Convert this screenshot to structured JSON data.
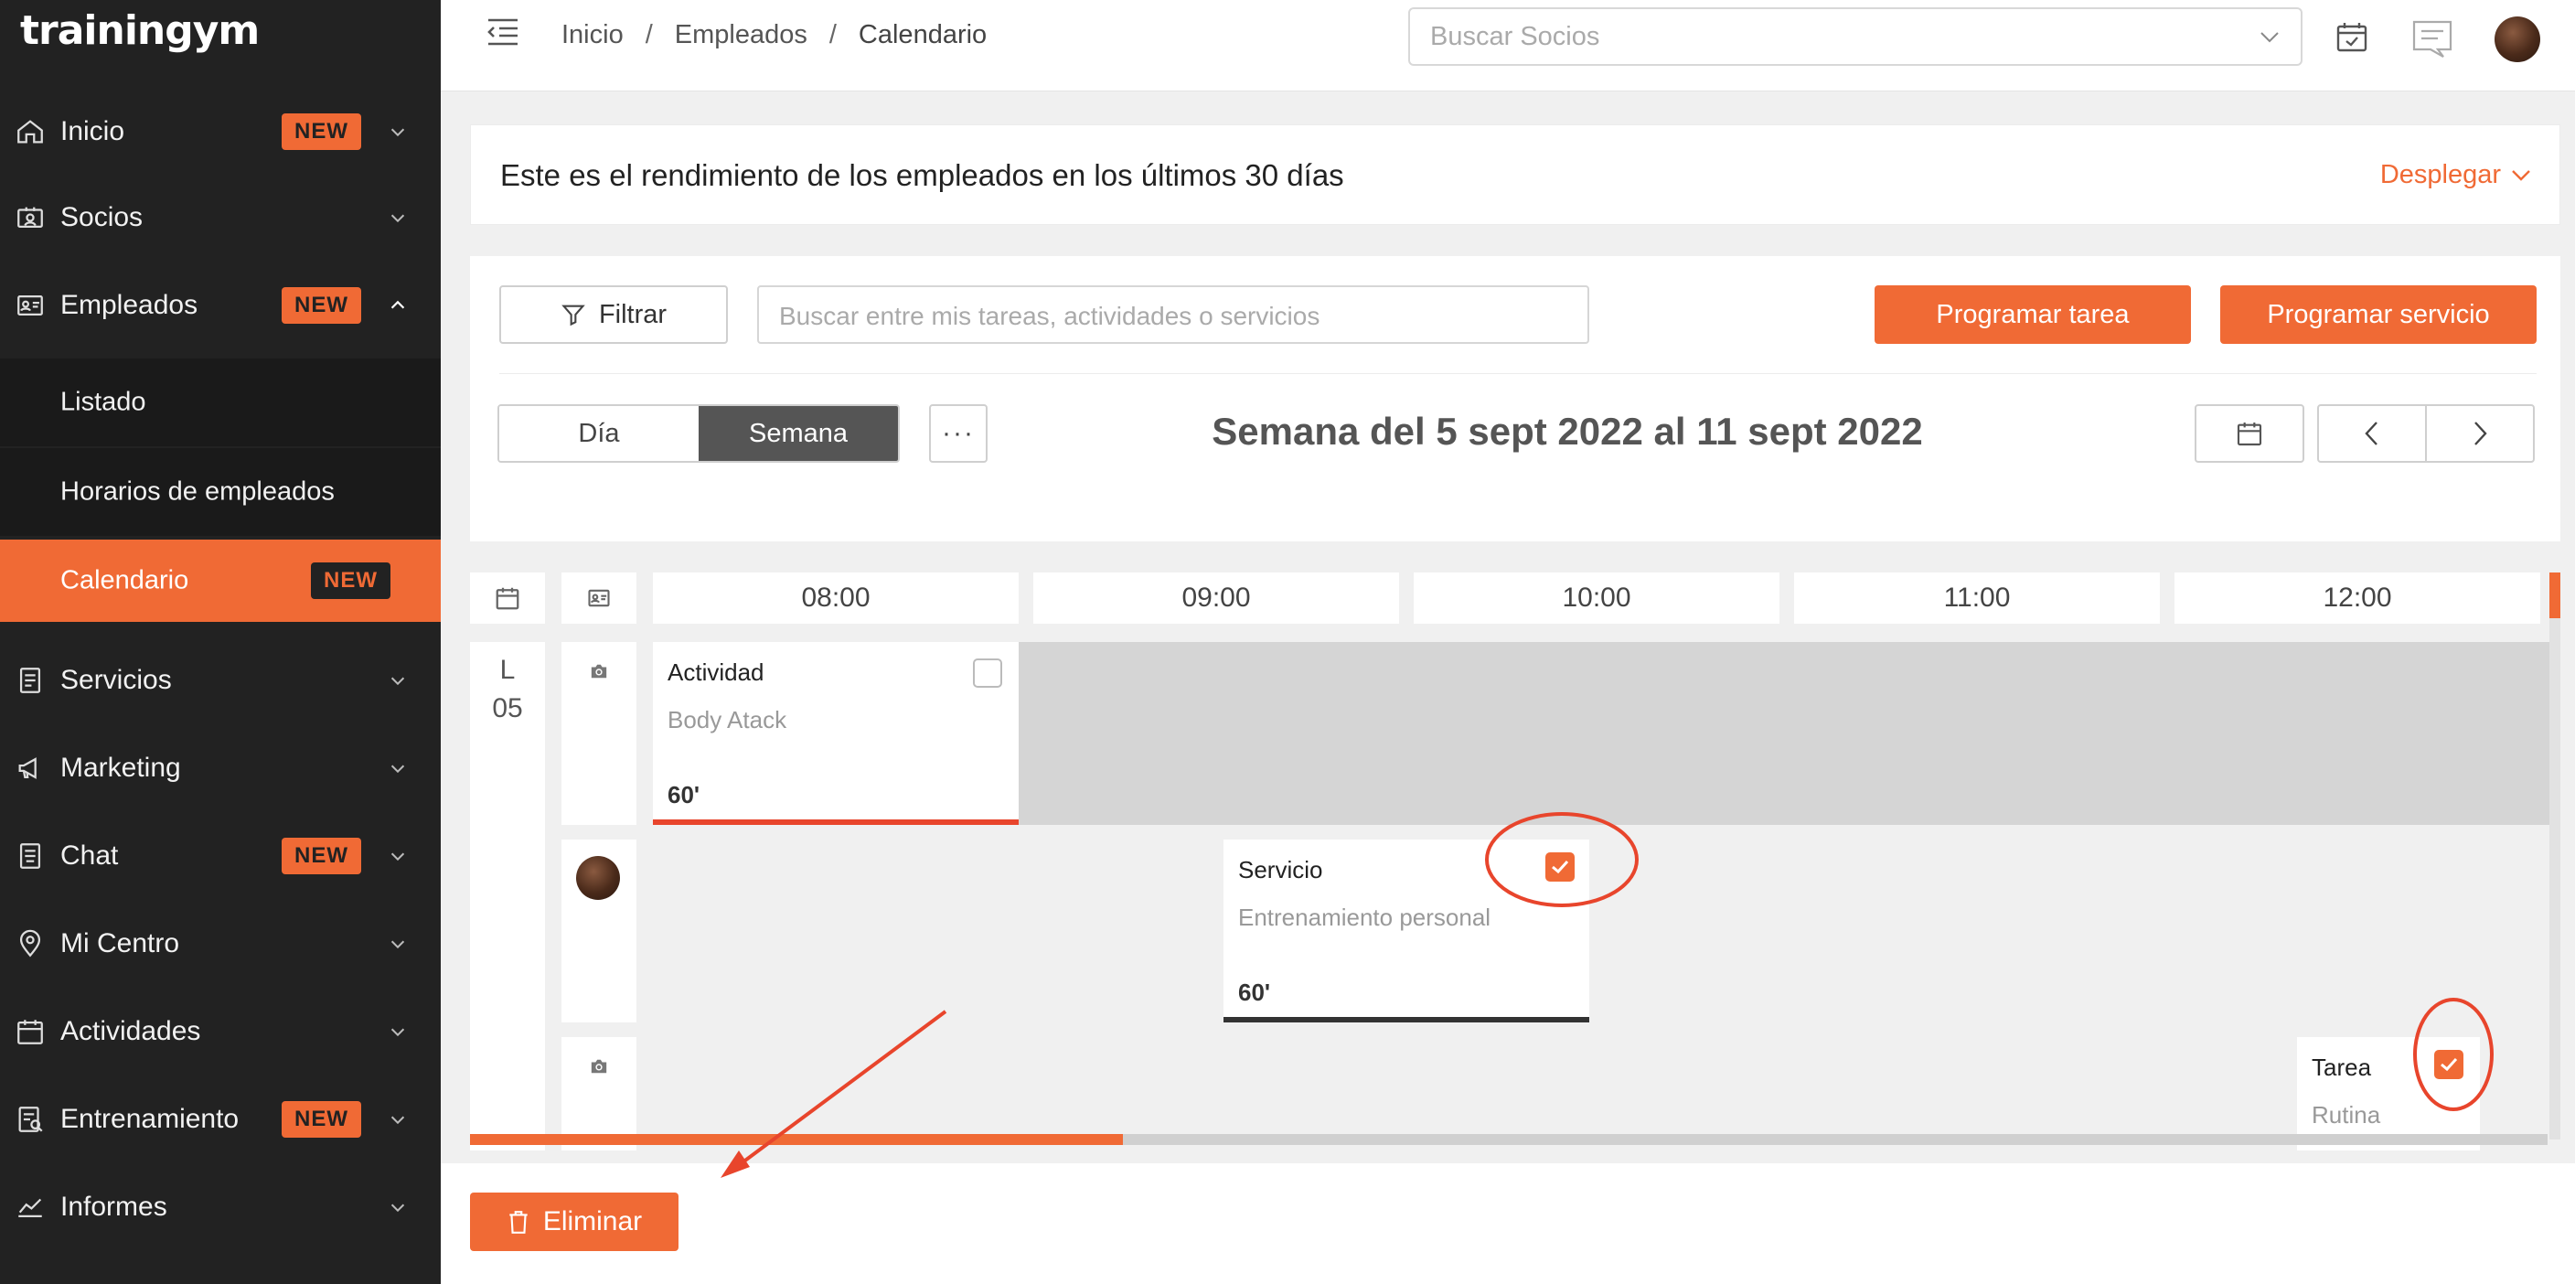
{
  "app": {
    "logo": "trainingym"
  },
  "sidebar": {
    "items": [
      {
        "label": "Inicio",
        "badge": "NEW",
        "icon": "home-icon"
      },
      {
        "label": "Socios",
        "badge": "",
        "icon": "members-card-icon"
      },
      {
        "label": "Empleados",
        "badge": "NEW",
        "icon": "employee-card-icon"
      },
      {
        "label": "Servicios",
        "badge": "",
        "icon": "services-doc-icon"
      },
      {
        "label": "Marketing",
        "badge": "",
        "icon": "megaphone-icon"
      },
      {
        "label": "Chat",
        "badge": "NEW",
        "icon": "chat-icon"
      },
      {
        "label": "Mi Centro",
        "badge": "",
        "icon": "location-pin-icon"
      },
      {
        "label": "Actividades",
        "badge": "",
        "icon": "calendar-icon"
      },
      {
        "label": "Entrenamiento",
        "badge": "NEW",
        "icon": "training-icon"
      },
      {
        "label": "Informes",
        "badge": "",
        "icon": "chart-line-icon"
      }
    ],
    "subitems": [
      {
        "label": "Listado",
        "badge": ""
      },
      {
        "label": "Horarios de empleados",
        "badge": ""
      },
      {
        "label": "Calendario",
        "badge": "NEW"
      }
    ]
  },
  "header": {
    "breadcrumb": [
      "Inicio",
      "/",
      "Empleados",
      "/",
      "Calendario"
    ],
    "search_placeholder": "Buscar Socios"
  },
  "performance": {
    "text": "Este es el rendimiento de los empleados en los últimos 30 días",
    "toggle": "Desplegar"
  },
  "controls": {
    "filter_label": "Filtrar",
    "search_placeholder": "Buscar entre mis tareas, actividades o servicios",
    "schedule_task": "Programar tarea",
    "schedule_service": "Programar servicio",
    "view_day": "Día",
    "view_week": "Semana",
    "more": "···",
    "week_title": "Semana del 5 sept 2022 al 11 sept 2022"
  },
  "calendar": {
    "hours": [
      "08:00",
      "09:00",
      "10:00",
      "11:00",
      "12:00"
    ],
    "day_letter": "L",
    "day_number": "05",
    "events": [
      {
        "type": "Actividad",
        "name": "Body Atack",
        "duration": "60'",
        "checked": false,
        "bar_color": "#e8452c"
      },
      {
        "type": "Servicio",
        "name": "Entrenamiento personal",
        "duration": "60'",
        "checked": true,
        "bar_color": "#333333"
      },
      {
        "type": "Tarea",
        "name": "Rutina",
        "duration": "",
        "checked": true,
        "bar_color": ""
      }
    ]
  },
  "footer": {
    "delete_label": "Eliminar"
  },
  "colors": {
    "accent": "#f06a35",
    "sidebar_bg": "#222222",
    "annotation": "#e8452c"
  }
}
